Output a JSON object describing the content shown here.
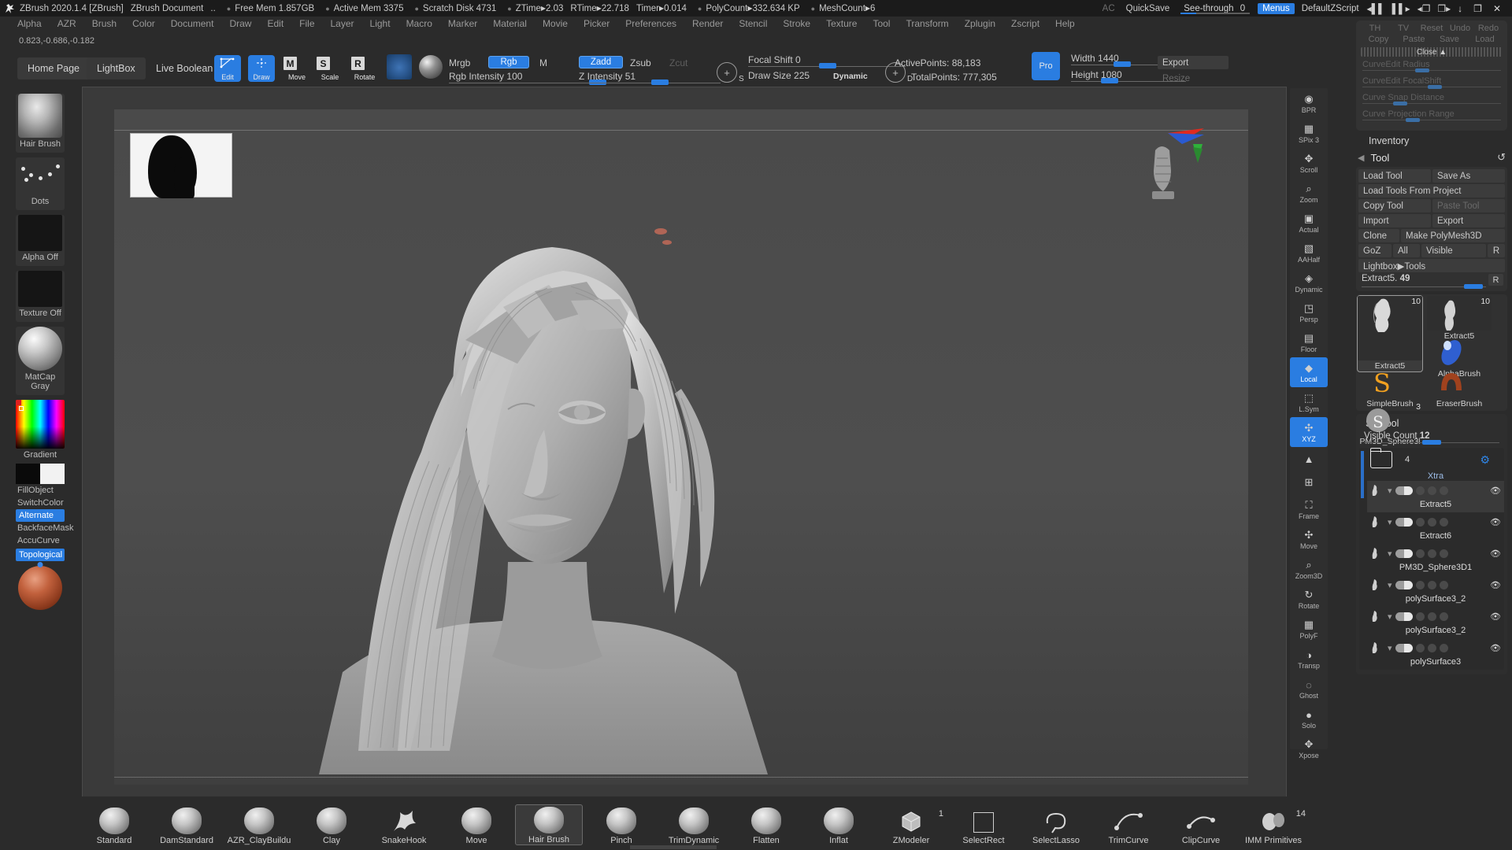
{
  "titlebar": {
    "app": "ZBrush 2020.1.4 [ZBrush]",
    "document": "ZBrush Document",
    "ellipsis": "..",
    "free_mem": "Free Mem 1.857GB",
    "active_mem": "Active Mem 3375",
    "scratch_disk": "Scratch Disk 4731",
    "ztime": "ZTime",
    "ztime_val": "2.03",
    "rtime": "RTime",
    "rtime_val": "22.718",
    "timer": "Timer",
    "timer_val": "0.014",
    "polycount": "PolyCount",
    "polycount_val": "332.634 KP",
    "meshcount": "MeshCount",
    "meshcount_val": "6",
    "ac": "AC",
    "quicksave": "QuickSave",
    "seethrough": "See-through",
    "seethrough_val": "0",
    "menus": "Menus",
    "zscript": "DefaultZScript",
    "minimize": "↓",
    "restore": "❐",
    "close": "✕"
  },
  "menubar": [
    "Alpha",
    "AZR",
    "Brush",
    "Color",
    "Document",
    "Draw",
    "Edit",
    "File",
    "Layer",
    "Light",
    "Macro",
    "Marker",
    "Material",
    "Movie",
    "Picker",
    "Preferences",
    "Render",
    "Stencil",
    "Stroke",
    "Texture",
    "Tool",
    "Transform",
    "Zplugin",
    "Zscript",
    "Help"
  ],
  "coords": "0.823,-0.686,-0.182",
  "toolbar": {
    "home_page": "Home Page",
    "lightbox": "LightBox",
    "live_boolean": "Live Boolean",
    "edit": "Edit",
    "draw": "Draw",
    "move": "Move",
    "move_key": "M",
    "scale": "Scale",
    "scale_key": "S",
    "rotate": "Rotate",
    "rotate_key": "R",
    "mrgb": "Mrgb",
    "rgb": "Rgb",
    "m": "M",
    "rgb_intensity_label": "Rgb Intensity",
    "rgb_intensity_value": "100",
    "zadd": "Zadd",
    "zsub": "Zsub",
    "zcut": "Zcut",
    "z_intensity_label": "Z Intensity",
    "z_intensity_value": "51",
    "focal_shift_label": "Focal Shift",
    "focal_shift_value": "0",
    "draw_size_label": "Draw Size",
    "draw_size_value": "225",
    "dynamic": "Dynamic",
    "s_key": "S",
    "d_key": "D",
    "active_points": "ActivePoints: 88,183",
    "total_points": "TotalPoints: 777,305",
    "pro": "Pro",
    "width_label": "Width",
    "width_value": "1440",
    "height_label": "Height",
    "height_value": "1080",
    "export": "Export",
    "resize": "Resize"
  },
  "left_shelf": [
    {
      "label": "Hair Brush",
      "name": "brush-preview"
    },
    {
      "label": "Dots",
      "name": "stroke-preview"
    },
    {
      "label": "Alpha Off",
      "name": "alpha-preview"
    },
    {
      "label": "Texture Off",
      "name": "texture-preview"
    },
    {
      "label": "MatCap Gray",
      "name": "material-preview"
    },
    {
      "label": "Gradient",
      "name": "color-picker"
    }
  ],
  "left_shelf_rows": {
    "fill_object": "FillObject",
    "switch_color": "SwitchColor",
    "alternate": "Alternate",
    "backface_mask": "BackfaceMask",
    "accu_curve": "AccuCurve",
    "topological": "Topological"
  },
  "right_shelf": [
    {
      "label": "BPR",
      "icon": "bpr-icon"
    },
    {
      "label": "SPix 3",
      "icon": "spix-icon"
    },
    {
      "label": "Scroll",
      "icon": "scroll-icon"
    },
    {
      "label": "Zoom",
      "icon": "zoom-icon"
    },
    {
      "label": "Actual",
      "icon": "actual-size-icon"
    },
    {
      "label": "AAHalf",
      "icon": "aahalf-icon"
    },
    {
      "label": "Dynamic",
      "icon": "dynamic-icon"
    },
    {
      "label": "Persp",
      "icon": "perspective-icon"
    },
    {
      "label": "Floor",
      "icon": "floor-grid-icon"
    },
    {
      "label": "Local",
      "icon": "local-icon"
    },
    {
      "label": "L.Sym",
      "icon": "local-symmetry-icon"
    },
    {
      "label": "XYZ",
      "icon": "xyz-icon"
    },
    {
      "label": "",
      "icon": "transp-arrow-icon"
    },
    {
      "label": "",
      "icon": "polyf-icon"
    },
    {
      "label": "Frame",
      "icon": "frame-icon"
    },
    {
      "label": "Move",
      "icon": "move-icon"
    },
    {
      "label": "Zoom3D",
      "icon": "zoom3d-icon"
    },
    {
      "label": "Rotate",
      "icon": "rotate-icon"
    },
    {
      "label": "PolyF",
      "icon": "polyframe-icon"
    },
    {
      "label": "Transp",
      "icon": "transparency-icon"
    },
    {
      "label": "Ghost",
      "icon": "ghost-icon"
    },
    {
      "label": "Solo",
      "icon": "solo-icon"
    },
    {
      "label": "Xpose",
      "icon": "xpose-icon"
    }
  ],
  "curve_panel": {
    "row1": [
      "TH",
      "TV",
      "Reset",
      "Undo",
      "Redo"
    ],
    "row2": [
      "Copy",
      "Paste",
      "Save",
      "Load"
    ],
    "close": "Close ▲",
    "sliders": [
      {
        "label": "CurveEdit Radius",
        "pos": 38
      },
      {
        "label": "CurveEdit FocalShift",
        "pos": 47
      },
      {
        "label": "Curve Snap Distance",
        "pos": 22
      },
      {
        "label": "Curve Projection Range",
        "pos": 31
      }
    ]
  },
  "inventory": "Inventory",
  "tool_panel": {
    "title": "Tool",
    "load_tool": "Load Tool",
    "save_as": "Save As",
    "load_tools_from_project": "Load Tools From Project",
    "copy_tool": "Copy Tool",
    "paste_tool": "Paste Tool",
    "import": "Import",
    "export": "Export",
    "clone": "Clone",
    "make_polymesh3d": "Make PolyMesh3D",
    "goz": "GoZ",
    "all": "All",
    "visible": "Visible",
    "r": "R",
    "lightbox_tools": "Lightbox▶Tools",
    "current_tool": "Extract5.",
    "current_tool_value": "49",
    "current_tool_r": "R"
  },
  "tool_grid": [
    {
      "name": "Extract5",
      "badge": "10",
      "selected": true,
      "kind": "mesh"
    },
    {
      "name": "Extract5",
      "badge": "10",
      "selected": false,
      "kind": "mesh-small"
    },
    {
      "name": "AlphaBrush",
      "badge": "",
      "selected": false,
      "kind": "alphabrush"
    },
    {
      "name": "SimpleBrush",
      "badge": "",
      "selected": false,
      "kind": "simplebrush"
    },
    {
      "name": "EraserBrush",
      "badge": "",
      "selected": false,
      "kind": "eraserbrush"
    },
    {
      "name": "PM3D_Sphere3l",
      "badge": "3",
      "selected": false,
      "kind": "sphere"
    }
  ],
  "subtool": {
    "title": "Subtool",
    "visible_count_label": "Visible Count",
    "visible_count_value": "12",
    "folder_count": "4",
    "folder_name": "Xtra",
    "items": [
      {
        "name": "Extract5",
        "selected": true
      },
      {
        "name": "Extract6",
        "selected": false
      },
      {
        "name": "PM3D_Sphere3D1",
        "selected": false
      },
      {
        "name": "polySurface3_2",
        "selected": false
      },
      {
        "name": "polySurface3_2",
        "selected": false
      },
      {
        "name": "polySurface3",
        "selected": false
      }
    ]
  },
  "bottom_brushes": [
    {
      "name": "Standard",
      "kind": "ball",
      "badge": ""
    },
    {
      "name": "DamStandard",
      "kind": "ball",
      "badge": ""
    },
    {
      "name": "AZR_ClayBuildu",
      "kind": "ball",
      "badge": ""
    },
    {
      "name": "Clay",
      "kind": "ball",
      "badge": ""
    },
    {
      "name": "SnakeHook",
      "kind": "snake",
      "badge": ""
    },
    {
      "name": "Move",
      "kind": "ball",
      "badge": ""
    },
    {
      "name": "Hair Brush",
      "kind": "ball",
      "badge": "",
      "selected": true
    },
    {
      "name": "Pinch",
      "kind": "ball",
      "badge": ""
    },
    {
      "name": "TrimDynamic",
      "kind": "ball",
      "badge": ""
    },
    {
      "name": "Flatten",
      "kind": "ball",
      "badge": ""
    },
    {
      "name": "Inflat",
      "kind": "ball",
      "badge": ""
    },
    {
      "name": "ZModeler",
      "kind": "cube",
      "badge": "1"
    },
    {
      "name": "SelectRect",
      "kind": "square",
      "badge": ""
    },
    {
      "name": "SelectLasso",
      "kind": "lasso",
      "badge": ""
    },
    {
      "name": "TrimCurve",
      "kind": "curve",
      "badge": ""
    },
    {
      "name": "ClipCurve",
      "kind": "clip",
      "badge": ""
    },
    {
      "name": "IMM Primitives",
      "kind": "imm",
      "badge": "14"
    }
  ],
  "colors": {
    "accent": "#2a7de1",
    "panel": "#2b2b2b",
    "canvas": "#4a4a4a",
    "titlebar": "#1b1b1b"
  }
}
